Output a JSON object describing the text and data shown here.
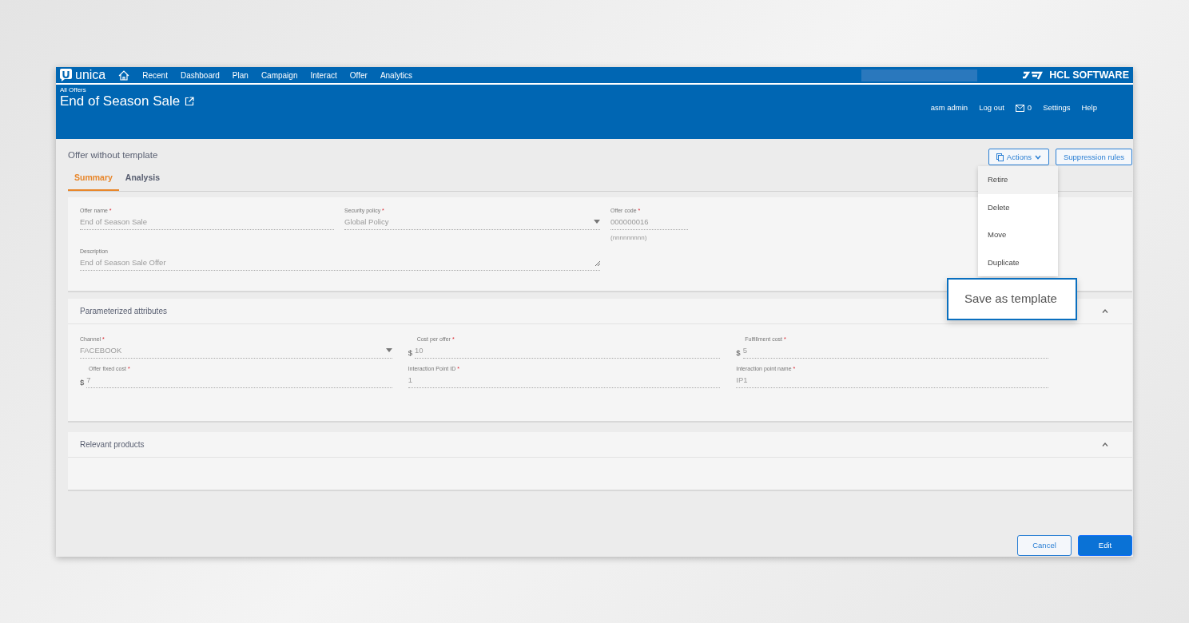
{
  "nav": {
    "brand": "unica",
    "items": [
      "Recent",
      "Dashboard",
      "Plan",
      "Campaign",
      "Interact",
      "Offer",
      "Analytics"
    ],
    "vendor": "HCL SOFTWARE"
  },
  "header": {
    "breadcrumb": "All Offers",
    "title": "End of Season Sale",
    "user": "asm admin",
    "logout": "Log out",
    "messages": "0",
    "settings": "Settings",
    "help": "Help"
  },
  "page": {
    "title": "Offer without template",
    "actions": "Actions",
    "suppression": "Suppression rules"
  },
  "tabs": [
    {
      "label": "Summary",
      "selected": true
    },
    {
      "label": "Analysis",
      "selected": false
    }
  ],
  "actions_menu": [
    {
      "label": "Retire",
      "kind": "item",
      "highlighted": true
    },
    {
      "label": "Delete",
      "kind": "item",
      "highlighted": false
    },
    {
      "label": "Move",
      "kind": "item",
      "highlighted": false
    },
    {
      "label": "Duplicate",
      "kind": "item",
      "highlighted": false
    },
    {
      "label": "Save as template",
      "kind": "callout"
    }
  ],
  "summary_fields": [
    {
      "label": "Offer name",
      "required_mark": "*",
      "value": "End of Season Sale",
      "kind": "text"
    },
    {
      "label": "Security policy",
      "required_mark": "*",
      "value": "Global Policy",
      "kind": "select"
    },
    {
      "label": "Offer code",
      "required_mark": "*",
      "value": "000000016",
      "kind": "text",
      "hint": "(nnnnnnnnn)"
    },
    {
      "label": "Description",
      "value": "End of Season Sale Offer",
      "kind": "textarea"
    }
  ],
  "sections": [
    {
      "title": "Parameterized attributes",
      "expanded": true,
      "fields": [
        {
          "label": "Channel",
          "required_mark": "*",
          "value": "FACEBOOK",
          "kind": "select"
        },
        {
          "label": "Cost per offer",
          "required_mark": "*",
          "value": "10",
          "kind": "text",
          "prefix": "$"
        },
        {
          "label": "Fulfillment cost",
          "required_mark": "*",
          "value": "5",
          "kind": "text",
          "prefix": "$"
        },
        {
          "label": "Offer fixed cost",
          "required_mark": "*",
          "value": "7",
          "kind": "text",
          "prefix": "$"
        },
        {
          "label": "Interaction Point ID",
          "required_mark": "*",
          "value": "1",
          "kind": "text"
        },
        {
          "label": "Interaction point name",
          "required_mark": "*",
          "value": "IP1",
          "kind": "text"
        }
      ]
    },
    {
      "title": "Relevant products",
      "expanded": true
    }
  ],
  "footer": {
    "cancel": "Cancel",
    "edit": "Edit"
  }
}
